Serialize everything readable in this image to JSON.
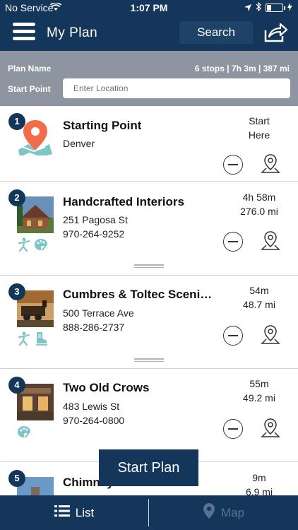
{
  "status_bar": {
    "carrier": "No Service",
    "time": "1:07 PM"
  },
  "header": {
    "title": "My Plan",
    "search_label": "Search"
  },
  "plan": {
    "name_label": "Plan Name",
    "summary": "6 stops | 7h 3m | 387 mi",
    "start_label": "Start Point",
    "location_placeholder": "Enter Location"
  },
  "stops": [
    {
      "number": "1",
      "title": "Starting Point",
      "line1": "Denver",
      "line2": "",
      "meta_top": "Start",
      "meta_bottom": "Here",
      "icons": []
    },
    {
      "number": "2",
      "title": "Handcrafted Interiors",
      "line1": "251 Pagosa St",
      "line2": "970-264-9252",
      "meta_top": "4h 58m",
      "meta_bottom": "276.0 mi",
      "icons": [
        "figure-icon",
        "palette-icon"
      ]
    },
    {
      "number": "3",
      "title": "Cumbres & Toltec Scenic...",
      "line1": "500 Terrace Ave",
      "line2": "888-286-2737",
      "meta_top": "54m",
      "meta_bottom": "48.7 mi",
      "icons": [
        "figure-icon",
        "boot-icon"
      ]
    },
    {
      "number": "4",
      "title": "Two Old Crows",
      "line1": "483 Lewis St",
      "line2": "970-264-0800",
      "meta_top": "55m",
      "meta_bottom": "49.2 mi",
      "icons": [
        "palette-icon"
      ]
    },
    {
      "number": "5",
      "title": "Chimney Rock...",
      "line1": "",
      "line2": "",
      "meta_top": "9m",
      "meta_bottom": "6.9 mi",
      "icons": []
    }
  ],
  "start_plan_label": "Start Plan",
  "tabs": {
    "list_label": "List",
    "map_label": "Map"
  },
  "colors": {
    "navy": "#13365a",
    "panel_gray": "#8d96a0",
    "pin_orange": "#f26b4b",
    "icon_teal": "#7fc4c6"
  }
}
